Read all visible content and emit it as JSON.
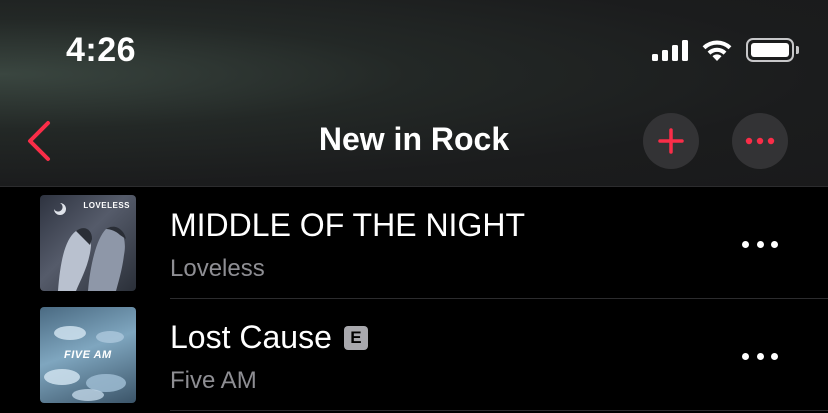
{
  "status_bar": {
    "time": "4:26",
    "signal_bars": 4,
    "wifi": "wifi-icon",
    "battery": "battery-full-icon"
  },
  "nav": {
    "title": "New in Rock",
    "back_icon": "chevron-left-icon",
    "add_icon": "plus-icon",
    "more_icon": "ellipsis-icon"
  },
  "colors": {
    "accent": "#fa2d48",
    "secondary_text": "#8e8e93",
    "button_bg": "#333335"
  },
  "tracks": [
    {
      "title": "MIDDLE OF THE NIGHT",
      "artist": "Loveless",
      "explicit": false,
      "art_text": "LOVELESS"
    },
    {
      "title": "Lost Cause",
      "artist": "Five AM",
      "explicit": true,
      "explicit_label": "E",
      "art_text": "FIVE AM"
    }
  ]
}
